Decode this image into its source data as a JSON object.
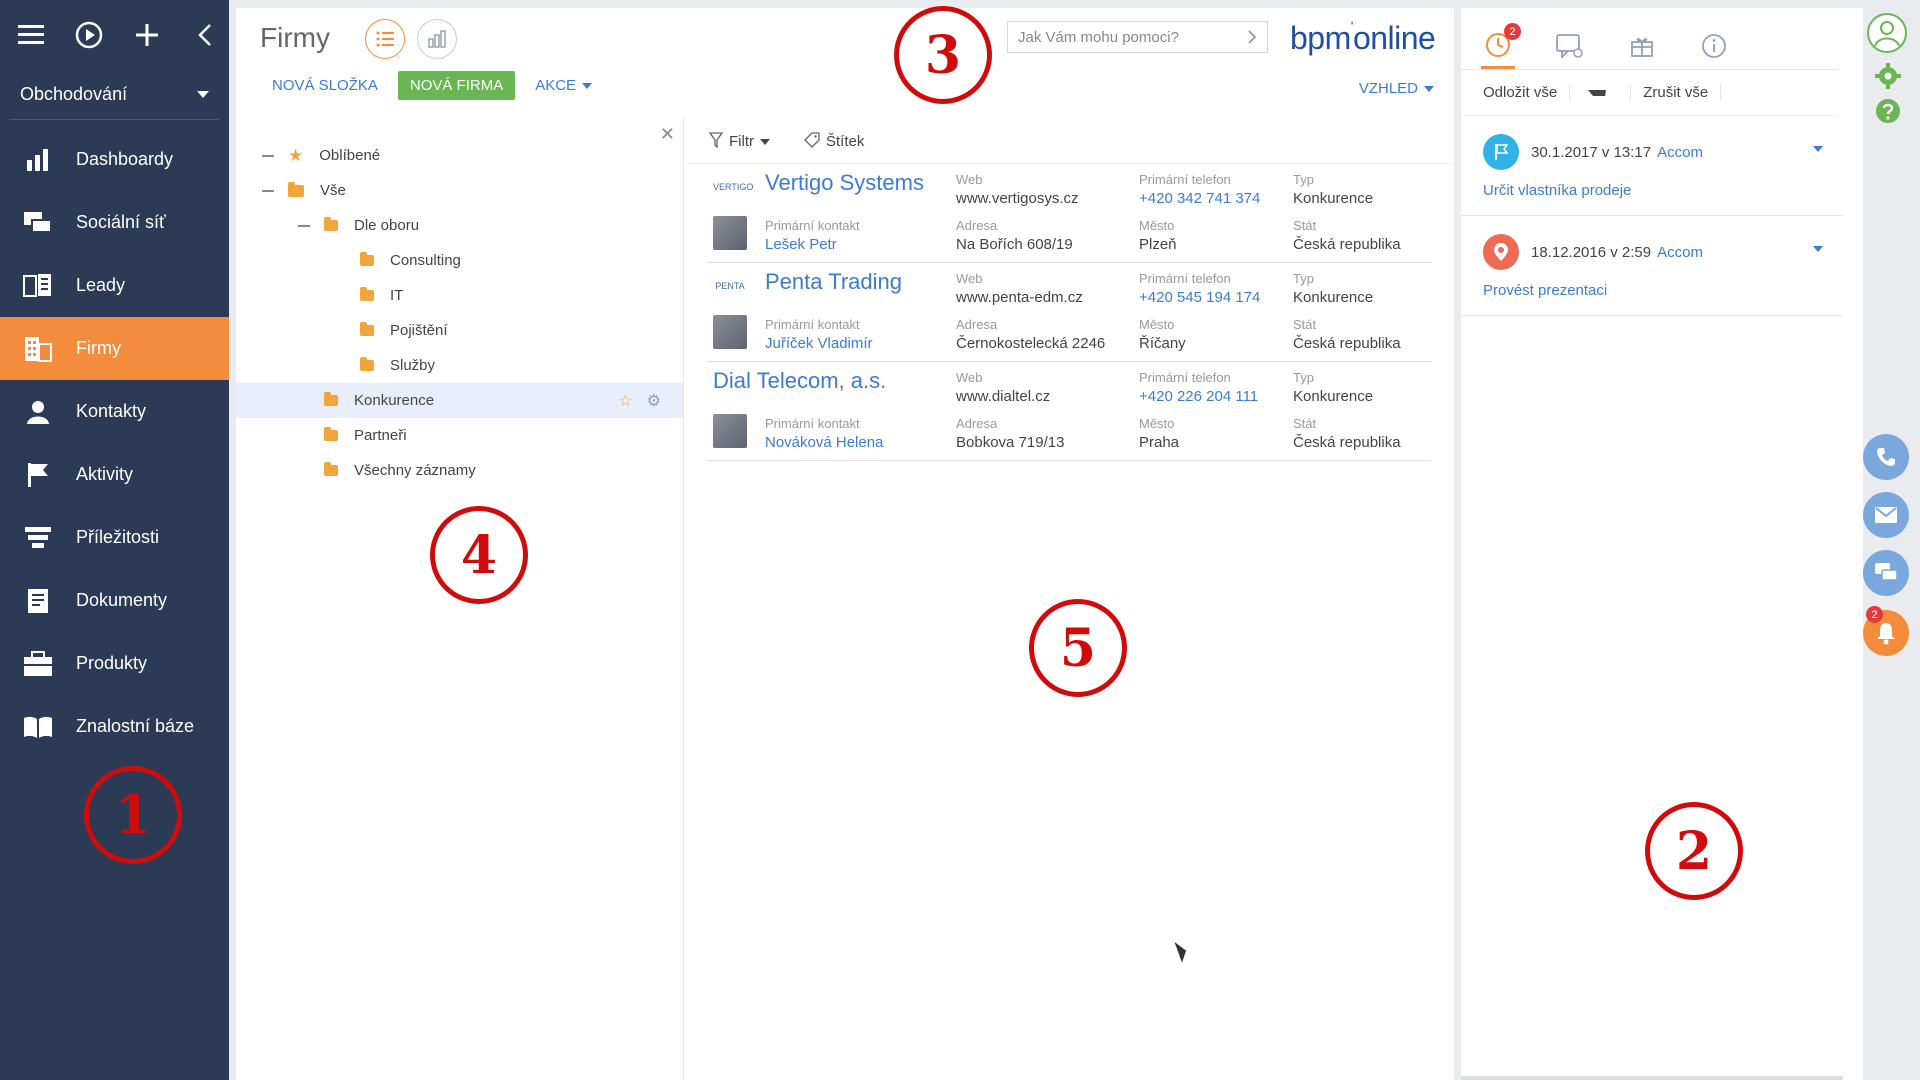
{
  "leftnav": {
    "workspace": "Obchodování",
    "items": [
      {
        "label": "Dashboardy",
        "icon": "bar-chart-icon",
        "active": false
      },
      {
        "label": "Sociální síť",
        "icon": "chat-icon",
        "active": false
      },
      {
        "label": "Leady",
        "icon": "leads-icon",
        "active": false
      },
      {
        "label": "Firmy",
        "icon": "building-icon",
        "active": true
      },
      {
        "label": "Kontakty",
        "icon": "person-icon",
        "active": false
      },
      {
        "label": "Aktivity",
        "icon": "flag-icon",
        "active": false
      },
      {
        "label": "Příležitosti",
        "icon": "funnel-icon",
        "active": false
      },
      {
        "label": "Dokumenty",
        "icon": "document-icon",
        "active": false
      },
      {
        "label": "Produkty",
        "icon": "product-icon",
        "active": false
      },
      {
        "label": "Znalostní báze",
        "icon": "book-icon",
        "active": false
      }
    ]
  },
  "header": {
    "title": "Firmy",
    "search_placeholder": "Jak Vám mohu pomoci?",
    "logo": "bpm",
    "logo_sup": "'",
    "logo_rest": "online",
    "actions": {
      "new_folder": "NOVÁ SLOŽKA",
      "new_company": "NOVÁ FIRMA",
      "akce": "AKCE"
    },
    "vzhled": "VZHLED"
  },
  "tree": {
    "items": [
      {
        "label": "Oblíbené",
        "level": 0,
        "kind": "star"
      },
      {
        "label": "Vše",
        "level": 0,
        "kind": "folder"
      },
      {
        "label": "Dle oboru",
        "level": 1,
        "kind": "folder"
      },
      {
        "label": "Consulting",
        "level": 2,
        "kind": "folder"
      },
      {
        "label": "IT",
        "level": 2,
        "kind": "folder"
      },
      {
        "label": "Pojištění",
        "level": 2,
        "kind": "folder"
      },
      {
        "label": "Služby",
        "level": 2,
        "kind": "folder"
      },
      {
        "label": "Konkurence",
        "level": 1,
        "kind": "folder",
        "selected": true
      },
      {
        "label": "Partneři",
        "level": 1,
        "kind": "folder"
      },
      {
        "label": "Všechny záznamy",
        "level": 1,
        "kind": "folder"
      }
    ]
  },
  "filter": {
    "filtr": "Filtr",
    "stitek": "Štítek"
  },
  "grid": {
    "labels": {
      "web": "Web",
      "phone": "Primární telefon",
      "type": "Typ",
      "contact": "Primární kontakt",
      "address": "Adresa",
      "city": "Město",
      "country": "Stát"
    },
    "records": [
      {
        "name": "Vertigo Systems",
        "logo": "VERTIGO",
        "web": "www.vertigosys.cz",
        "phone": "+420 342 741 374",
        "type": "Konkurence",
        "contact": "Lešek Petr",
        "address": "Na Bořích 608/19",
        "city": "Plzeň",
        "country": "Česká republika"
      },
      {
        "name": "Penta Trading",
        "logo": "PENTA",
        "web": "www.penta-edm.cz",
        "phone": "+420 545 194 174",
        "type": "Konkurence",
        "contact": "Juříček Vladimír",
        "address": "Černokostelecká 2246",
        "city": "Říčany",
        "country": "Česká republika"
      },
      {
        "name": "Dial Telecom, a.s.",
        "logo": "",
        "web": "www.dialtel.cz",
        "phone": "+420 226 204 111",
        "type": "Konkurence",
        "contact": "Nováková Helena",
        "address": "Bobkova 719/13",
        "city": "Praha",
        "country": "Česká republika"
      }
    ]
  },
  "rpanel": {
    "badge": "2",
    "btn_postpone": "Odložit vše",
    "btn_cancel": "Zrušit vše",
    "notifications": [
      {
        "date": "30.1.2017 v 13:17",
        "owner": "Accom",
        "task": "Určit vlastníka prodeje",
        "color": "#2fb3e8",
        "icon": "flag-icon"
      },
      {
        "date": "18.12.2016 v 2:59",
        "owner": "Accom",
        "task": "Provést prezentaci",
        "color": "#ef6a52",
        "icon": "pin-icon"
      }
    ]
  },
  "strip": {
    "notif_badge": "2"
  },
  "annotations": [
    "1",
    "2",
    "3",
    "4",
    "5"
  ],
  "colors": {
    "nav_bg": "#2b3a55",
    "accent": "#f48c3d",
    "link": "#3c7bd3",
    "primary_btn": "#6ab654",
    "annotation": "#d10b0b"
  }
}
